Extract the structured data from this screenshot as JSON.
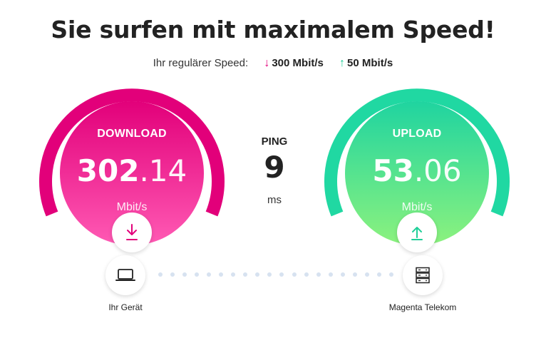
{
  "heading": "Sie surfen mit maximalem Speed!",
  "regular_speed": {
    "label": "Ihr regulärer Speed:",
    "download": "300 Mbit/s",
    "upload": "50 Mbit/s",
    "download_arrow": "↓",
    "upload_arrow": "↑"
  },
  "download": {
    "label": "DOWNLOAD",
    "value_int": "302",
    "value_dec": ".14",
    "unit": "Mbit/s",
    "icon": "download-arrow-icon",
    "color_top": "#e2007a",
    "color_bottom": "#ff5ab4"
  },
  "ping": {
    "label": "PING",
    "value": "9",
    "unit": "ms"
  },
  "upload": {
    "label": "UPLOAD",
    "value_int": "53",
    "value_dec": ".06",
    "unit": "Mbit/s",
    "icon": "upload-arrow-icon",
    "color_top": "#1fd4a0",
    "color_bottom": "#8cf27e"
  },
  "devices": {
    "left": {
      "label": "Ihr Gerät",
      "icon": "laptop-icon"
    },
    "right": {
      "label": "Magenta Telekom",
      "icon": "server-icon"
    }
  }
}
